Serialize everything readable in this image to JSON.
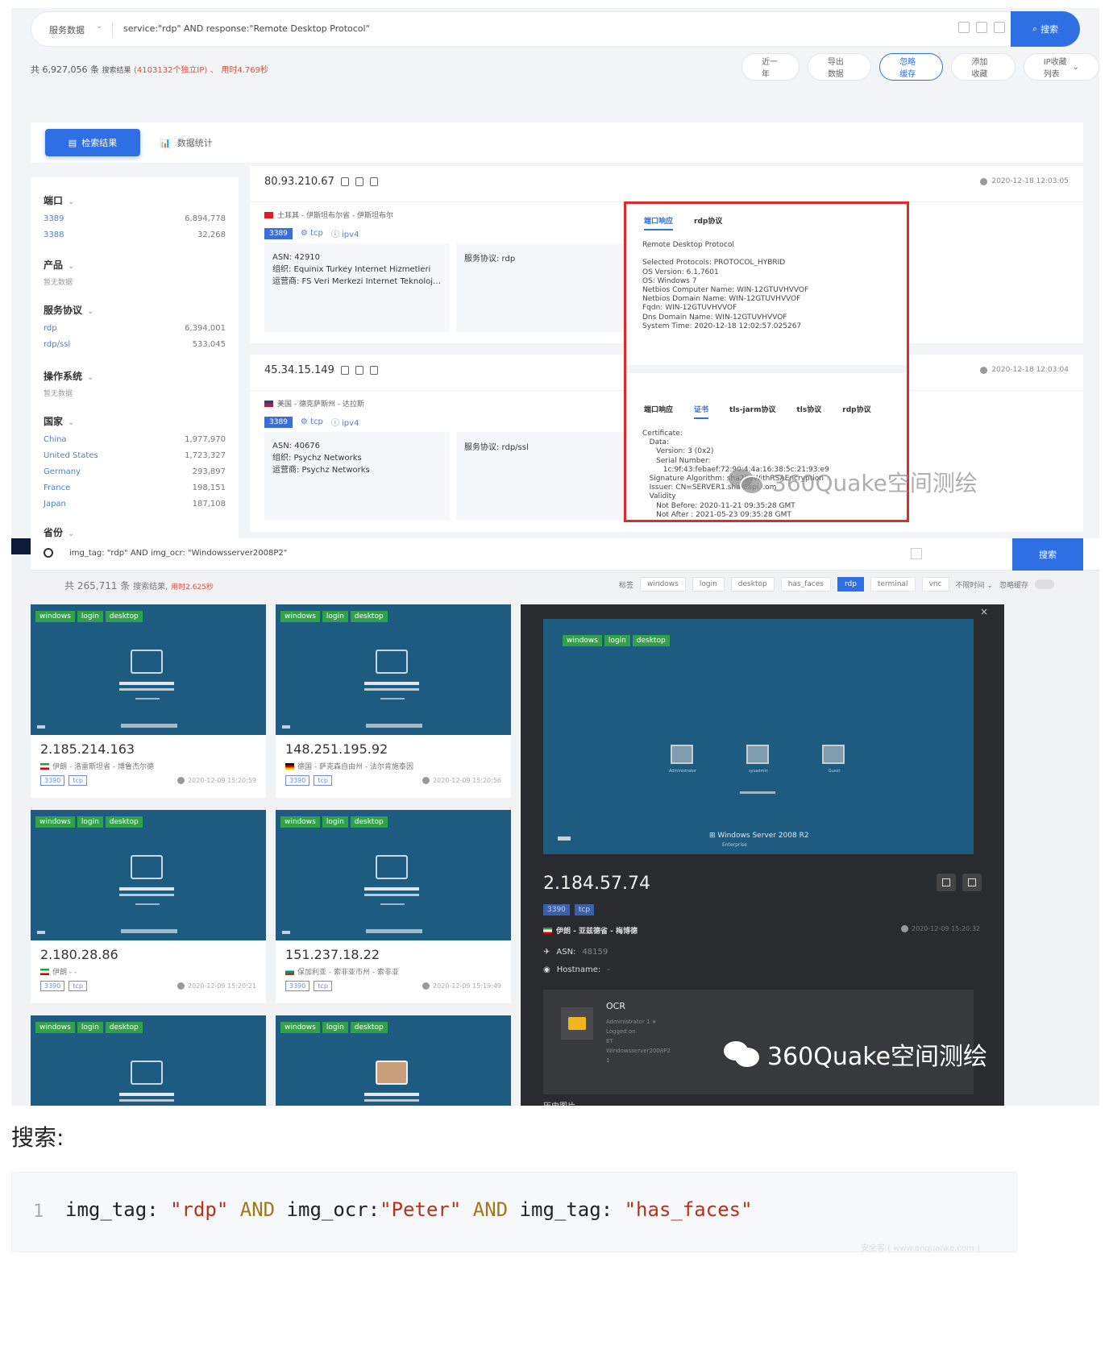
{
  "shot1": {
    "search": {
      "category": "服务数据",
      "query": "service:\"rdp\" AND response:\"Remote Desktop Protocol\"",
      "button": "搜索"
    },
    "stats": {
      "prefix": "共",
      "count": "6,927,056",
      "unit": "条",
      "label": "搜索结果",
      "unique": "(4103132个独立IP)",
      "dot": "、",
      "time": "用时4.769秒"
    },
    "actions": [
      "近一年",
      "导出数据",
      "忽略缓存",
      "添加收藏",
      "IP收藏列表"
    ],
    "tabs": {
      "active": "检索结果",
      "other": "数据统计"
    },
    "sidebar": [
      {
        "title": "端口",
        "items": [
          {
            "k": "3389",
            "v": "6,894,778"
          },
          {
            "k": "3388",
            "v": "32,268"
          }
        ]
      },
      {
        "title": "产品",
        "empty": "暂无数据"
      },
      {
        "title": "服务协议",
        "items": [
          {
            "k": "rdp",
            "v": "6,394,001"
          },
          {
            "k": "rdp/ssl",
            "v": "533,045"
          }
        ]
      },
      {
        "title": "操作系统",
        "empty": "暂无数据"
      },
      {
        "title": "国家",
        "items": [
          {
            "k": "China",
            "v": "1,977,970"
          },
          {
            "k": "United States",
            "v": "1,723,327"
          },
          {
            "k": "Germany",
            "v": "293,897"
          },
          {
            "k": "France",
            "v": "198,151"
          },
          {
            "k": "Japan",
            "v": "187,108"
          }
        ]
      },
      {
        "title": "省份"
      }
    ],
    "cards": [
      {
        "ip": "80.93.210.67",
        "time": "2020-12-18 12:03:05",
        "location": "土耳其 - 伊斯坦布尔省 - 伊斯坦布尔",
        "port": "3389",
        "proto": "tcp",
        "ipv": "ipv4",
        "asn": "ASN:  42910",
        "org": "组织:  Equinix Turkey Internet Hizmetleri",
        "isp": "运营商:  FS Veri Merkezi Internet Teknolojileri",
        "service": "服务协议:  rdp"
      },
      {
        "ip": "45.34.15.149",
        "time": "2020-12-18 12:03:04",
        "location": "美国 - 德克萨斯州 - 达拉斯",
        "port": "3389",
        "proto": "tcp",
        "ipv": "ipv4",
        "asn": "ASN:  40676",
        "org": "组织:  Psychz Networks",
        "isp": "运营商:  Psychz Networks",
        "service": "服务协议:  rdp/ssl"
      }
    ],
    "panel1": {
      "tabs": [
        "端口响应",
        "rdp协议"
      ],
      "text": "Remote Desktop Protocol\n\nSelected Protocols: PROTOCOL_HYBRID\nOS Version: 6.1.7601\nOS: Windows 7\nNetbios Computer Name: WIN-12GTUVHVVOF\nNetbios Domain Name: WIN-12GTUVHVVOF\nFqdn: WIN-12GTUVHVVOF\nDns Domain Name: WIN-12GTUVHVVOF\nSystem Time: 2020-12-18 12:02:57.025267"
    },
    "panel2": {
      "tabs": [
        "端口响应",
        "证书",
        "tls-jarm协议",
        "tls协议",
        "rdp协议"
      ],
      "text": "Certificate:\n   Data:\n      Version: 3 (0x2)\n      Serial Number:\n         1c:9f:43:febaef:72:90:4:4a:16:38:5c:21:93:e9\n   Signature Algorithm: sha256WithRSAEncryption\n   Issuer: CN=SERVER1.shareapi.com\n   Validity\n      Not Before: 2020-11-21 09:35:28 GMT\n      Not After : 2021-05-23 09:35:28 GMT"
    },
    "watermark": "360Quake空间测绘"
  },
  "shot2": {
    "search": {
      "query": "img_tag: \"rdp\"  AND img_ocr: \"Windowsserver2008P2\"",
      "button": "搜索"
    },
    "stats": {
      "prefix": "共",
      "count": "265,711",
      "unit": "条",
      "label": "搜索结果,",
      "time": "用时2.625秒"
    },
    "filters": {
      "label": "标签",
      "chips": [
        "windows",
        "login",
        "desktop",
        "has_faces",
        "rdp",
        "terminal",
        "vnc"
      ],
      "active": "rdp",
      "time_label": "不限时间",
      "cache_label": "忽略缓存"
    },
    "image_tags": [
      "windows",
      "login",
      "desktop"
    ],
    "tiles": [
      {
        "ip": "2.185.214.163",
        "loc": "伊朗 - 洛雷斯坦省 - 博鲁杰尔德",
        "port": "3390",
        "proto": "tcp",
        "time": "2020-12-09 15:20:59"
      },
      {
        "ip": "148.251.195.92",
        "loc": "德国 - 萨克森自由州 - 法尔肯施泰因",
        "port": "3390",
        "proto": "tcp",
        "time": "2020-12-09 15:20:56"
      },
      {
        "ip": "2.180.28.86",
        "loc": "伊朗 - -",
        "port": "3390",
        "proto": "tcp",
        "time": "2020-12-09 15:20:21"
      },
      {
        "ip": "151.237.18.22",
        "loc": "保加利亚 - 索非亚市州 - 索非亚",
        "port": "3390",
        "proto": "tcp",
        "time": "2020-12-09 15:19:49"
      }
    ],
    "detail": {
      "ip": "2.184.57.74",
      "port": "3390",
      "proto": "tcp",
      "loc": "伊朗 - 亚兹德省 - 梅博德",
      "time": "2020-12-09 15:20:32",
      "asn_label": "ASN:",
      "asn": "48159",
      "host_label": "Hostname:",
      "host": "-",
      "ocr_title": "OCR",
      "ocr_text": "Administrator 1 ∗\nLogged on\nET\nWindowsserver2008P2\n1",
      "history": "历史图片",
      "users": [
        "Administrator",
        "sysadmin",
        "Guest"
      ],
      "brand": "Windows Server 2008 R2",
      "edition": "Enterprise"
    },
    "watermark": "360Quake空间测绘"
  },
  "search_label": "搜索:",
  "code": {
    "line": "1",
    "tokens": [
      {
        "t": "img_tag: ",
        "c": "plain"
      },
      {
        "t": "\"rdp\"",
        "c": "str"
      },
      {
        "t": " AND ",
        "c": "kw"
      },
      {
        "t": "img_ocr:",
        "c": "plain"
      },
      {
        "t": "\"Peter\"",
        "c": "str"
      },
      {
        "t": " AND ",
        "c": "kw"
      },
      {
        "t": "img_tag: ",
        "c": "plain"
      },
      {
        "t": "\"has_faces\"",
        "c": "str"
      }
    ]
  },
  "footer_watermark": "安全客 ( www.anquanke.com )",
  "colors": {
    "primary": "#2f6fe4",
    "highlight": "#e12a2a",
    "tag_green": "#31a14a",
    "screen_blue": "#1e5b80"
  }
}
